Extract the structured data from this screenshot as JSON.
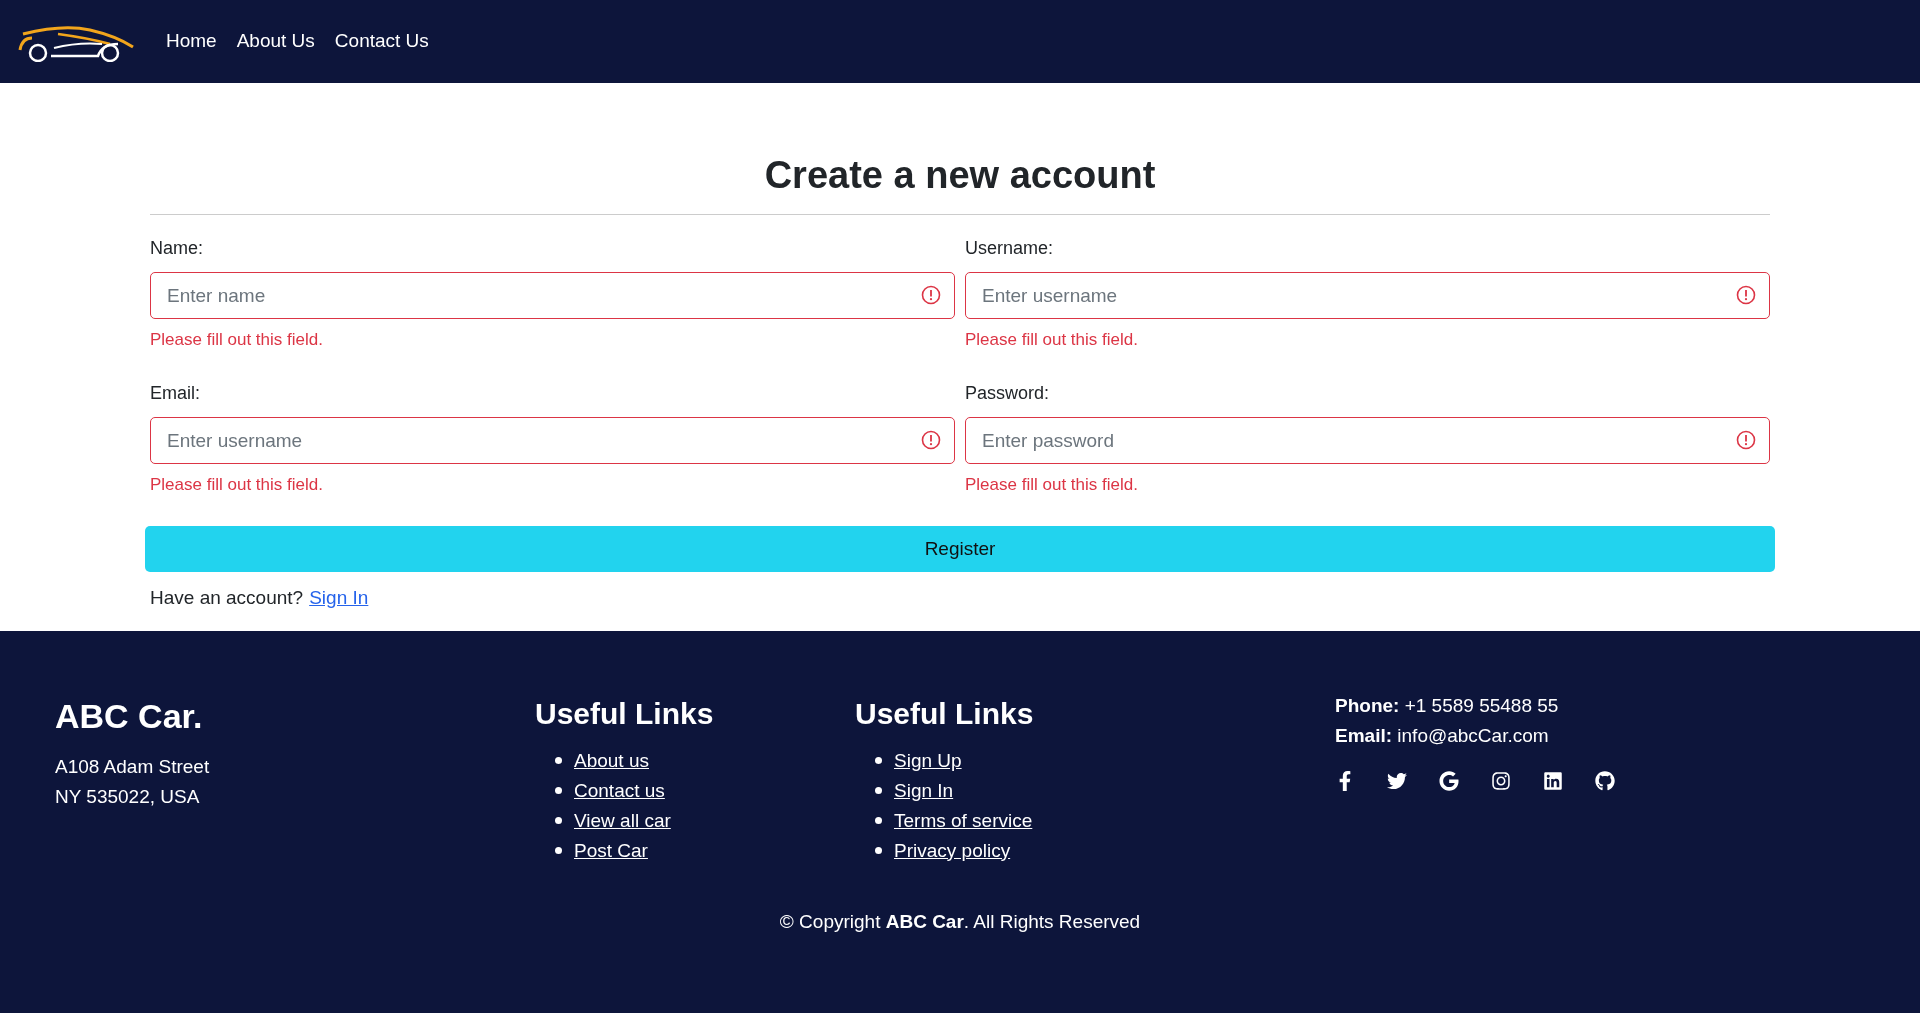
{
  "navbar": {
    "links": [
      {
        "label": "Home"
      },
      {
        "label": "About Us"
      },
      {
        "label": "Contact Us"
      }
    ]
  },
  "form": {
    "title": "Create a new account",
    "fields": [
      {
        "label": "Name:",
        "placeholder": "Enter name",
        "invalid": true,
        "error": "Please fill out this field."
      },
      {
        "label": "Username:",
        "placeholder": "Enter username",
        "invalid": true,
        "error": "Please fill out this field."
      },
      {
        "label": "Email:",
        "placeholder": "Enter username",
        "invalid": true,
        "error": "Please fill out this field."
      },
      {
        "label": "Password:",
        "placeholder": "Enter password",
        "invalid": true,
        "error": "Please fill out this field."
      }
    ],
    "submit": "Register",
    "signin_prompt": "Have an account?",
    "signin_link": "Sign In"
  },
  "footer": {
    "brand": "ABC Car.",
    "address": [
      "A108 Adam Street",
      "NY 535022, USA"
    ],
    "link_groups": [
      {
        "title": "Useful Links",
        "links": [
          "About us",
          "Contact us",
          "View all car",
          "Post Car"
        ]
      },
      {
        "title": "Useful Links",
        "links": [
          "Sign Up",
          "Sign In",
          "Terms of service",
          "Privacy policy"
        ]
      }
    ],
    "contact": [
      "**Phone:** +1 5589 55488 55",
      "**Email:** info@abcCar.com"
    ],
    "copyright": "© Copyright **ABC Car**. All Rights Reserved"
  }
}
